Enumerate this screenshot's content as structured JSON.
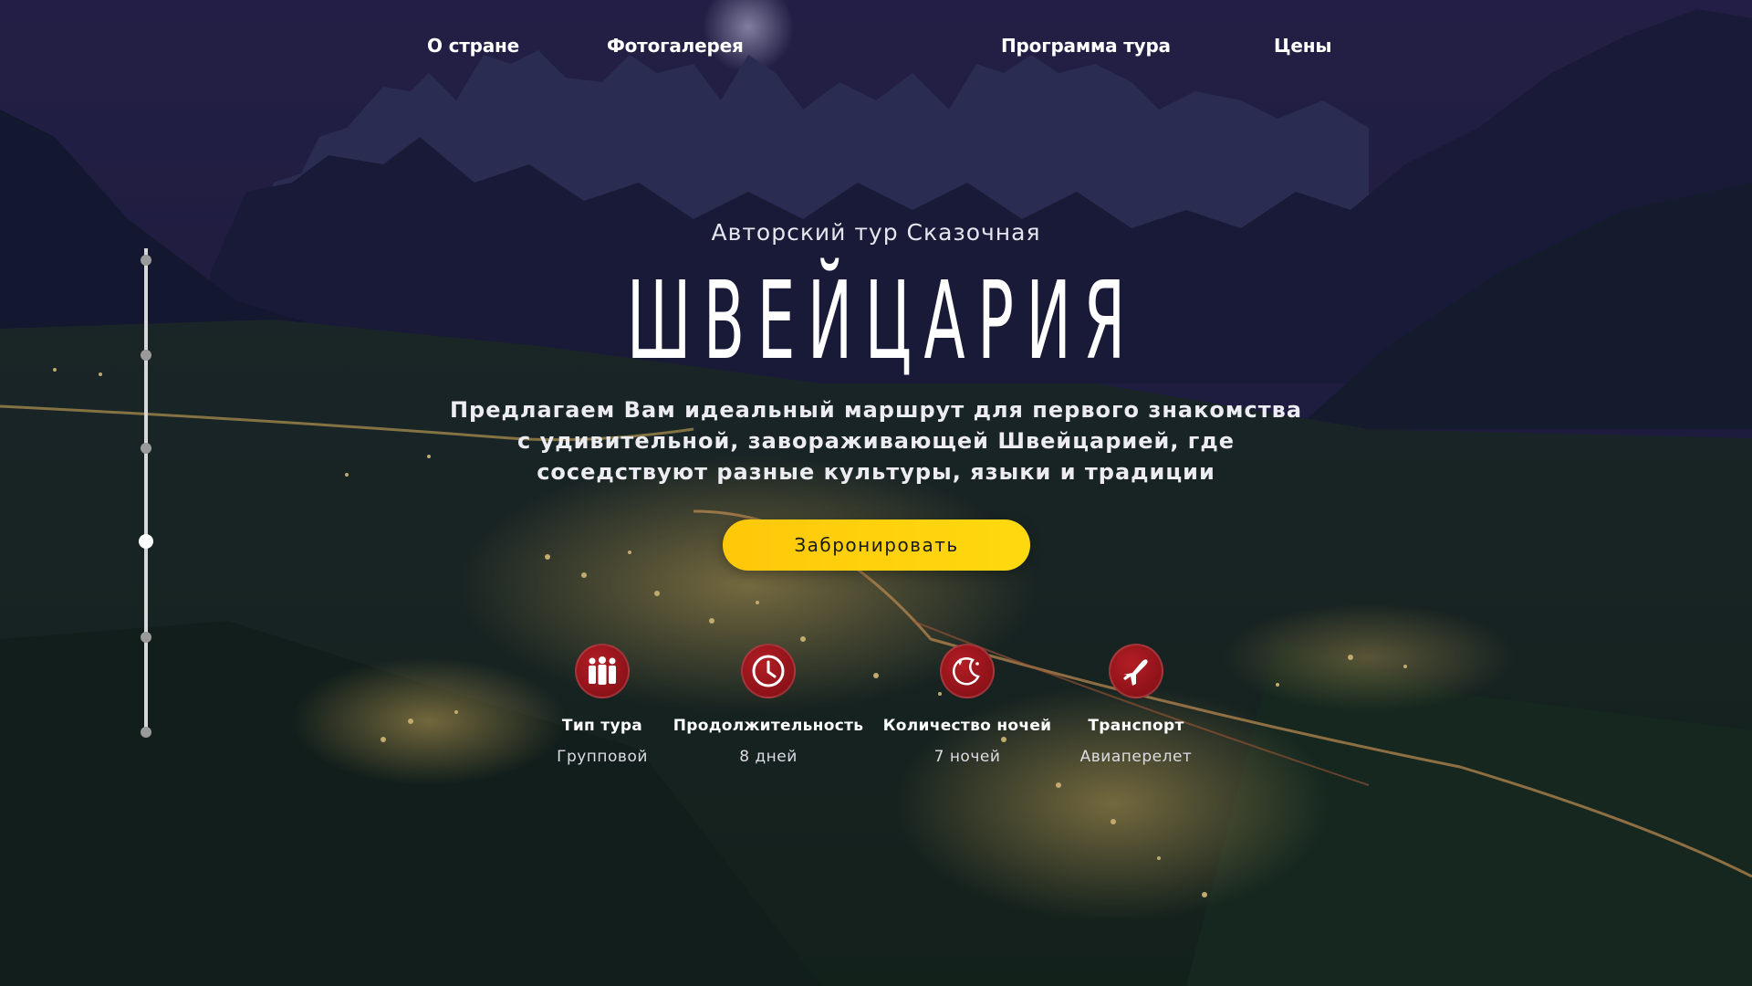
{
  "nav": {
    "items": [
      {
        "label": "О стране"
      },
      {
        "label": "Фотогалерея"
      },
      {
        "label": "Программа тура"
      },
      {
        "label": "Цены"
      }
    ]
  },
  "hero": {
    "subtitle": "Авторский тур Сказочная",
    "title": "ШВЕЙЦАРИЯ",
    "description_lines": [
      "Предлагаем Вам идеальный маршрут для первого знакомства",
      "с удивительной, завораживающей Швейцарией, где",
      "соседствуют разные культуры, языки и традиции"
    ],
    "cta_label": "Забронировать"
  },
  "timeline": {
    "steps": 6,
    "active_step": 4
  },
  "features": [
    {
      "icon": "group-people-icon",
      "label": "Тип тура",
      "value": "Групповой"
    },
    {
      "icon": "clock-icon",
      "label": "Продолжительность",
      "value": "8 дней"
    },
    {
      "icon": "moon-night-icon",
      "label": "Количество ночей",
      "value": "7 ночей"
    },
    {
      "icon": "airplane-icon",
      "label": "Транспорт",
      "value": "Авиаперелет"
    }
  ],
  "colors": {
    "accent": "#ffd20c",
    "icon_bg": "#9b141b",
    "sky": "#2a2350"
  }
}
